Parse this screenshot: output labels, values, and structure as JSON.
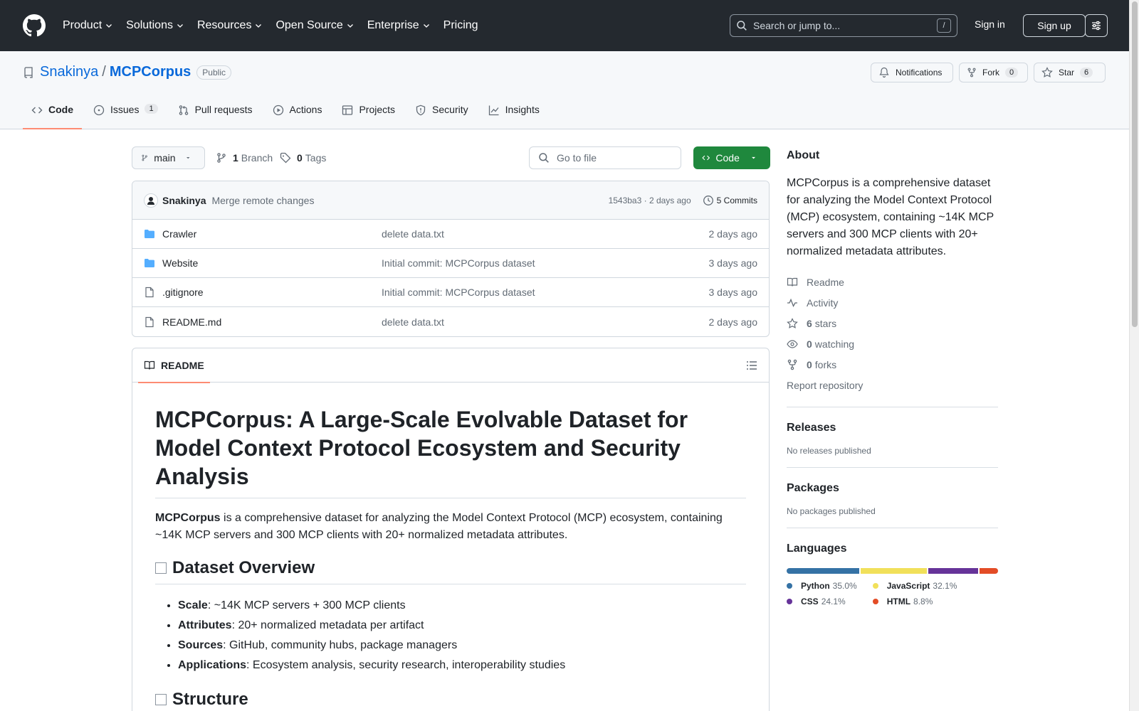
{
  "header": {
    "nav": [
      "Product",
      "Solutions",
      "Resources",
      "Open Source",
      "Enterprise",
      "Pricing"
    ],
    "search_placeholder": "Search or jump to...",
    "search_key": "/",
    "signin": "Sign in",
    "signup": "Sign up"
  },
  "repo": {
    "owner": "Snakinya",
    "separator": "/",
    "name": "MCPCorpus",
    "visibility": "Public",
    "notifications": "Notifications",
    "fork_label": "Fork",
    "fork_count": "0",
    "star_label": "Star",
    "star_count": "6"
  },
  "tabs": [
    {
      "label": "Code",
      "icon": "code-icon",
      "active": true
    },
    {
      "label": "Issues",
      "icon": "issue-icon",
      "count": "1"
    },
    {
      "label": "Pull requests",
      "icon": "pull-request-icon"
    },
    {
      "label": "Actions",
      "icon": "play-icon"
    },
    {
      "label": "Projects",
      "icon": "table-icon"
    },
    {
      "label": "Security",
      "icon": "shield-icon"
    },
    {
      "label": "Insights",
      "icon": "graph-icon"
    }
  ],
  "toolbar": {
    "branch": "main",
    "branches_count": "1",
    "branches_label": "Branch",
    "tags_count": "0",
    "tags_label": "Tags",
    "gotofile_placeholder": "Go to file",
    "code_button": "Code"
  },
  "latest_commit": {
    "author": "Snakinya",
    "message": "Merge remote changes",
    "sha_time": "1543ba3 · 2 days ago",
    "commits": "5 Commits"
  },
  "files": [
    {
      "name": "Crawler",
      "type": "folder",
      "message": "delete data.txt",
      "date": "2 days ago"
    },
    {
      "name": "Website",
      "type": "folder",
      "message": "Initial commit: MCPCorpus dataset",
      "date": "3 days ago"
    },
    {
      "name": ".gitignore",
      "type": "file",
      "message": "Initial commit: MCPCorpus dataset",
      "date": "3 days ago"
    },
    {
      "name": "README.md",
      "type": "file",
      "message": "delete data.txt",
      "date": "2 days ago"
    }
  ],
  "readme": {
    "tab_label": "README",
    "title": "MCPCorpus: A Large-Scale Evolvable Dataset for Model Context Protocol Ecosystem and Security Analysis",
    "intro_bold": "MCPCorpus",
    "intro_rest": " is a comprehensive dataset for analyzing the Model Context Protocol (MCP) ecosystem, containing ~14K MCP servers and 300 MCP clients with 20+ normalized metadata attributes.",
    "section1": "Dataset Overview",
    "bullets": [
      {
        "k": "Scale",
        "v": ": ~14K MCP servers + 300 MCP clients"
      },
      {
        "k": "Attributes",
        "v": ": 20+ normalized metadata per artifact"
      },
      {
        "k": "Sources",
        "v": ": GitHub, community hubs, package managers"
      },
      {
        "k": "Applications",
        "v": ": Ecosystem analysis, security research, interoperability studies"
      }
    ],
    "section2": "Structure"
  },
  "about": {
    "heading": "About",
    "description": "MCPCorpus is a comprehensive dataset for analyzing the Model Context Protocol (MCP) ecosystem, containing ~14K MCP servers and 300 MCP clients with 20+ normalized metadata attributes.",
    "readme": "Readme",
    "activity": "Activity",
    "stars_count": "6",
    "stars_label": "stars",
    "watching_count": "0",
    "watching_label": "watching",
    "forks_count": "0",
    "forks_label": "forks",
    "report": "Report repository"
  },
  "releases": {
    "heading": "Releases",
    "empty": "No releases published"
  },
  "packages": {
    "heading": "Packages",
    "empty": "No packages published"
  },
  "languages": {
    "heading": "Languages",
    "items": [
      {
        "name": "Python",
        "percent": "35.0%",
        "value": 35.0,
        "color": "#3572A5"
      },
      {
        "name": "JavaScript",
        "percent": "32.1%",
        "value": 32.1,
        "color": "#f1e05a"
      },
      {
        "name": "CSS",
        "percent": "24.1%",
        "value": 24.1,
        "color": "#663399"
      },
      {
        "name": "HTML",
        "percent": "8.8%",
        "value": 8.8,
        "color": "#e34c26"
      }
    ]
  }
}
